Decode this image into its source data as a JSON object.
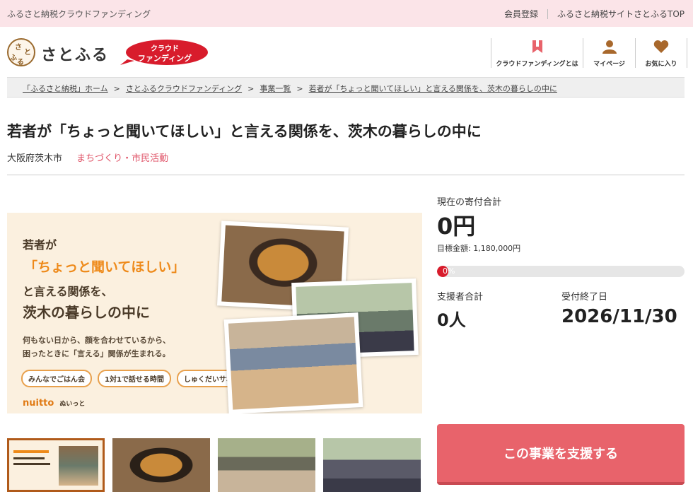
{
  "topbar": {
    "site_name": "ふるさと納税クラウドファンディング",
    "links": [
      "会員登録",
      "ふるさと納税サイトさとふるTOP"
    ]
  },
  "header": {
    "logo_text": "さとふる",
    "logo_mark_chars": [
      "さ",
      "と",
      "ふ",
      "る"
    ],
    "badge_line1": "クラウド",
    "badge_line2": "ファンディング",
    "nav": [
      {
        "label": "クラウドファンディングとは",
        "icon": "bookmark-icon"
      },
      {
        "label": "マイページ",
        "icon": "person-icon"
      },
      {
        "label": "お気に入り",
        "icon": "heart-icon"
      }
    ]
  },
  "breadcrumb": [
    "「ふるさと納税」ホーム",
    "さとふるクラウドファンディング",
    "事業一覧",
    "若者が「ちょっと聞いてほしい」と言える関係を、茨木の暮らしの中に"
  ],
  "project": {
    "title": "若者が「ちょっと聞いてほしい」と言える関係を、茨木の暮らしの中に",
    "city": "大阪府茨木市",
    "category": "まちづくり・市民活動"
  },
  "hero": {
    "line1": "若者が",
    "line2": "「ちょっと聞いてほしい」",
    "line3": "と言える関係を、",
    "line4": "茨木の暮らしの中に",
    "sub1": "何もない日から、顔を合わせているから、",
    "sub2": "困ったときに「言える」関係が生まれる。",
    "tags": [
      "みんなでごはん会",
      "1対1で話せる時間",
      "しゅくだいサポート"
    ],
    "brand": "nuitto",
    "brand_kana": "ぬいっと"
  },
  "stats": {
    "total_label": "現在の寄付合計",
    "total_value": "0円",
    "goal": "目標金額: 1,180,000円",
    "progress_text": "0%",
    "progress_fraction": 0,
    "backers_label": "支援者合計",
    "backers_value": "0人",
    "end_label": "受付終了日",
    "end_value": "2026/11/30"
  },
  "cta": {
    "label": "この事業を支援する"
  },
  "colors": {
    "accent": "#e8636b",
    "brand_red": "#d81c2c",
    "topbar": "#fbe4e8",
    "category": "#e0566a"
  }
}
